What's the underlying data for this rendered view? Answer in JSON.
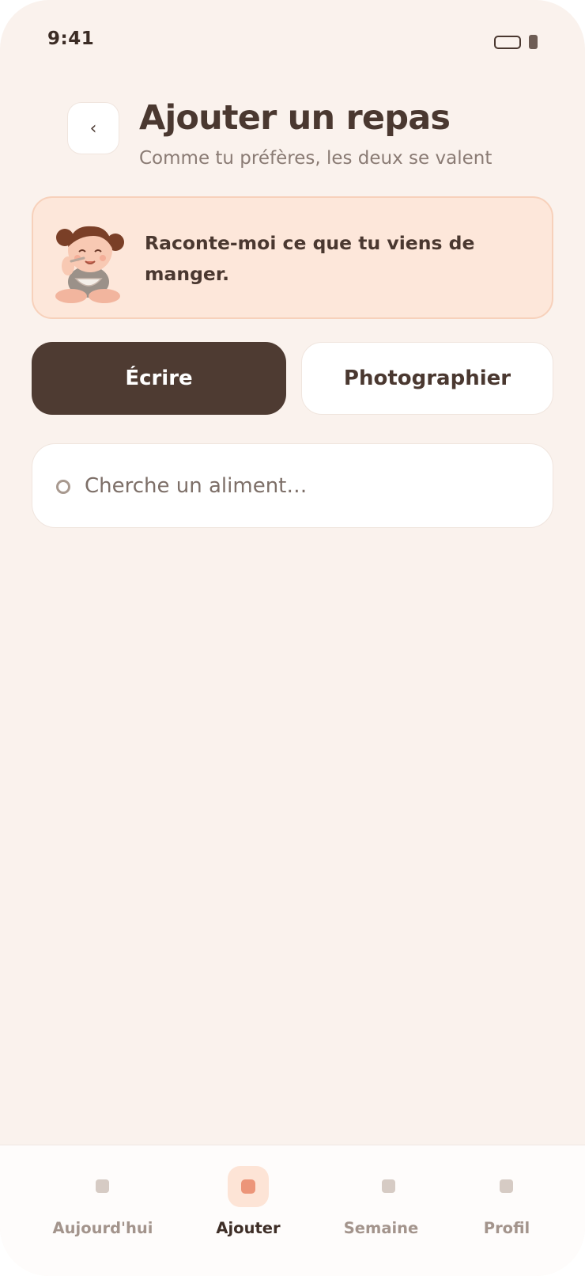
{
  "status_bar": {
    "time": "9:41"
  },
  "header": {
    "back_label": "‹",
    "title": "Ajouter un repas",
    "subtitle": "Comme tu préfères, les deux se valent"
  },
  "banner": {
    "message": "Raconte-moi ce que tu viens de manger."
  },
  "tabs": [
    {
      "label": "Écrire",
      "active": true
    },
    {
      "label": "Photographier",
      "active": false
    }
  ],
  "search": {
    "placeholder": "Cherche un aliment…",
    "value": ""
  },
  "bottom_nav": {
    "items": [
      {
        "label": "Aujourd'hui",
        "active": false
      },
      {
        "label": "Ajouter",
        "active": true
      },
      {
        "label": "Semaine",
        "active": false
      },
      {
        "label": "Profil",
        "active": false
      }
    ]
  },
  "colors": {
    "background": "#faf2ed",
    "primary_dark": "#4e3b32",
    "banner_bg": "#fde7da",
    "accent": "#ec9579"
  }
}
